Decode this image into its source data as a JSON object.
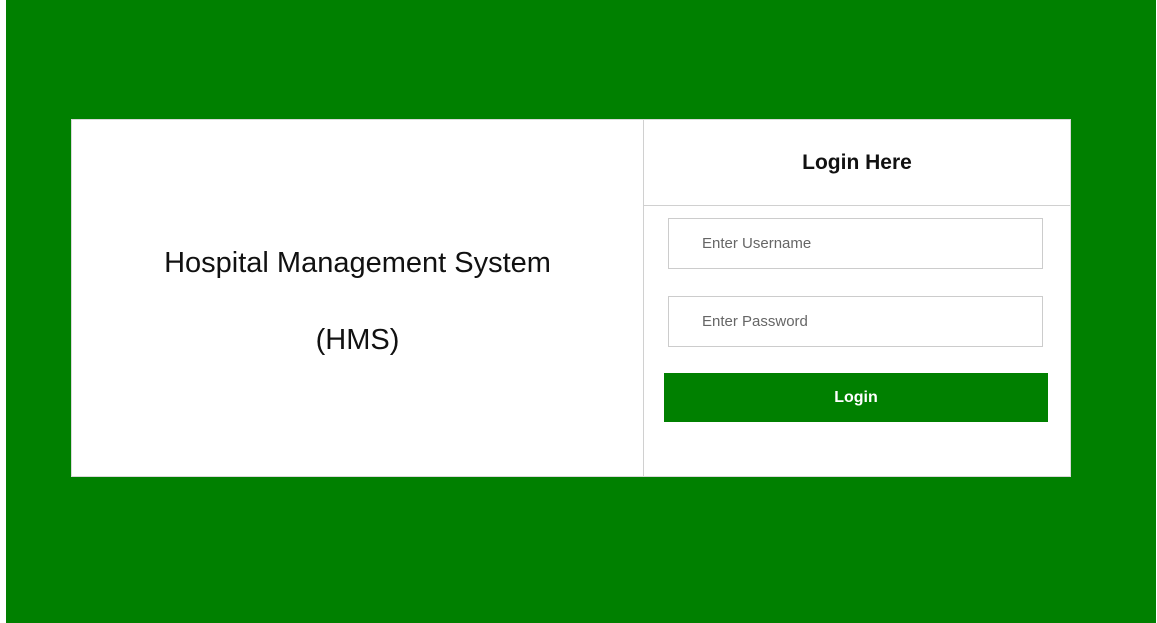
{
  "branding": {
    "title": "Hospital Management System",
    "abbreviation": "(HMS)"
  },
  "login": {
    "heading": "Login Here",
    "username_placeholder": "Enter Username",
    "password_placeholder": "Enter Password",
    "submit_label": "Login"
  },
  "colors": {
    "background": "#008000",
    "button": "#008000",
    "card": "#ffffff"
  }
}
